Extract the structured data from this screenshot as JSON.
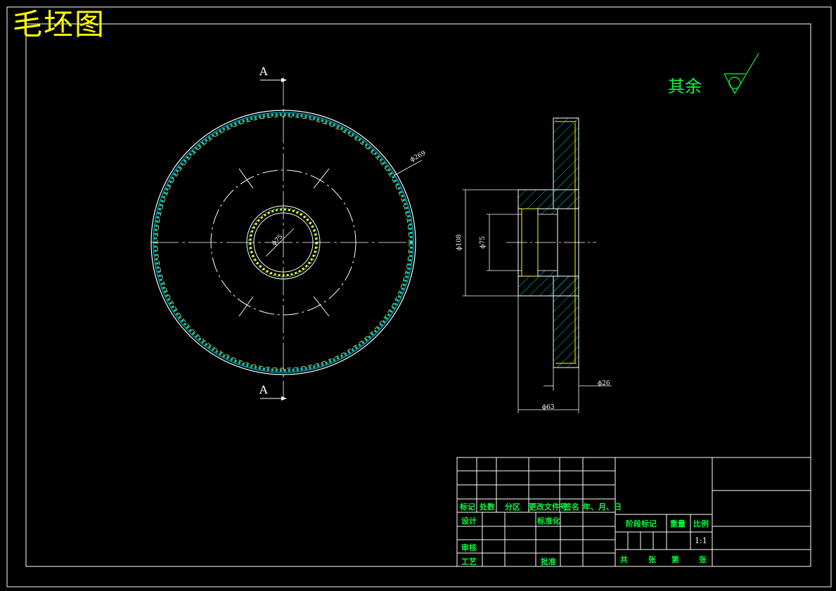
{
  "drawing": {
    "title": "毛坯图",
    "surface_note": "其余",
    "section_labels": [
      "A",
      "A"
    ],
    "dimensions": {
      "outer_diameter": "ϕ269",
      "inner_diameter": "ϕ75",
      "flange_diameter": "ϕ108",
      "bore_diameter": "ϕ75",
      "thickness": "ϕ26",
      "hub_length": "ϕ63"
    }
  },
  "title_block": {
    "col_headers": [
      "标记",
      "处数",
      "分区",
      "更改文件号",
      "签名",
      "年、月、日"
    ],
    "design": "设计",
    "standardization": "标准化",
    "review": "审核",
    "process": "工艺",
    "approve": "批准",
    "stage_mark": "阶段标记",
    "weight": "重量",
    "scale": "比例",
    "scale_value": "1:1",
    "total": "共",
    "sheets": "张",
    "sheet_no": "第",
    "sheet_unit": "张"
  },
  "colors": {
    "background": "#000000",
    "lines": "#ffffff",
    "title": "#ffff00",
    "hatch": "#00c8c8",
    "text_green": "#00ff3c"
  }
}
